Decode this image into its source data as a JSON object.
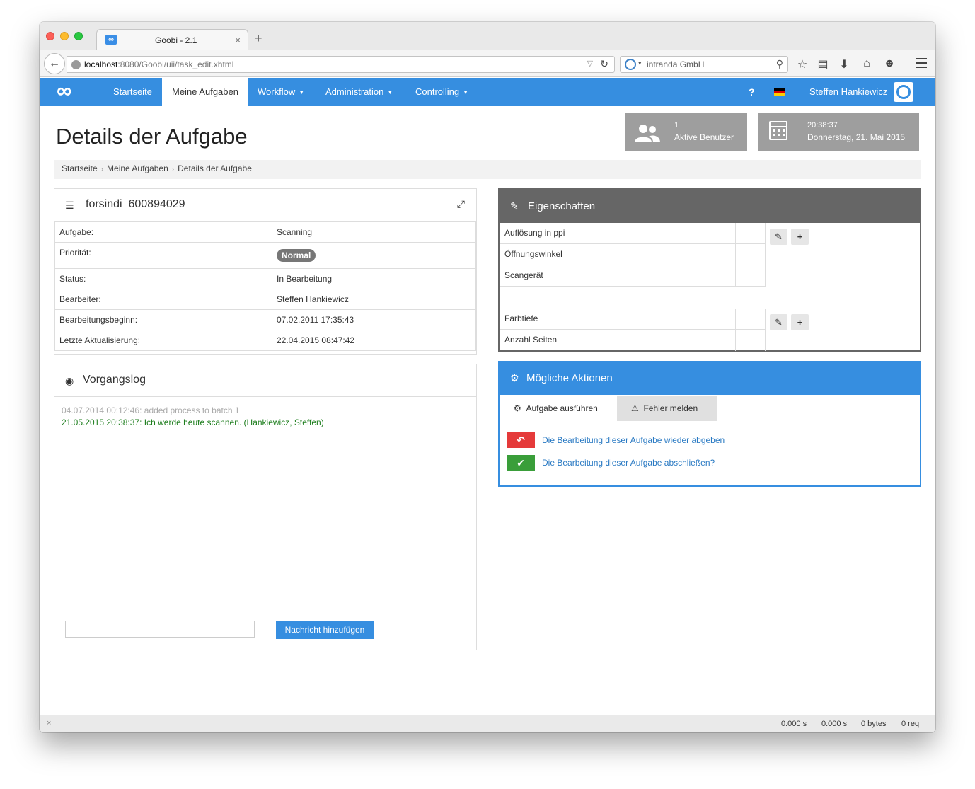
{
  "browser": {
    "tab_title": "Goobi - 2.1",
    "tab_icon_glyph": "∞",
    "tab_close": "×",
    "new_tab": "+",
    "url_host": "localhost",
    "url_path": ":8080/Goobi/uii/task_edit.xhtml",
    "search_text": "intranda GmbH"
  },
  "nav": {
    "logo": "∞",
    "items": [
      {
        "label": "Startseite",
        "caret": false
      },
      {
        "label": "Meine Aufgaben",
        "caret": false
      },
      {
        "label": "Workflow",
        "caret": true
      },
      {
        "label": "Administration",
        "caret": true
      },
      {
        "label": "Controlling",
        "caret": true
      }
    ],
    "active_index": 1,
    "help": "?",
    "user": "Steffen Hankiewicz"
  },
  "page": {
    "title": "Details der Aufgabe",
    "users_count": "1",
    "users_label": "Aktive Benutzer",
    "time": "20:38:37",
    "date": "Donnerstag, 21. Mai 2015"
  },
  "breadcrumb": [
    "Startseite",
    "Meine Aufgaben",
    "Details der Aufgabe"
  ],
  "details": {
    "title": "forsindi_600894029",
    "rows": [
      {
        "key": "Aufgabe:",
        "value": "Scanning"
      },
      {
        "key": "Priorität:",
        "value": "Normal"
      },
      {
        "key": "Status:",
        "value": "In Bearbeitung"
      },
      {
        "key": "Bearbeiter:",
        "value": "Steffen Hankiewicz"
      },
      {
        "key": "Bearbeitungsbeginn:",
        "value": "07.02.2011 17:35:43"
      },
      {
        "key": "Letzte Aktualisierung:",
        "value": "22.04.2015 08:47:42"
      }
    ]
  },
  "log": {
    "title": "Vorgangslog",
    "entries": [
      {
        "text": "04.07.2014 00:12:46: added process to batch 1"
      },
      {
        "text": "21.05.2015 20:38:37: Ich werde heute scannen. (Hankiewicz, Steffen)"
      }
    ],
    "input_value": "",
    "button_label": "Nachricht hinzufügen"
  },
  "properties": {
    "title": "Eigenschaften",
    "group1": [
      "Auflösung in ppi",
      "Öffnungswinkel",
      "Scangerät"
    ],
    "group2": [
      "Farbtiefe",
      "Anzahl Seiten"
    ]
  },
  "actions": {
    "title": "Mögliche Aktionen",
    "tab_execute": "Aufgabe ausführen",
    "tab_error": "Fehler melden",
    "return_label": "Die Bearbeitung dieser Aufgabe wieder abgeben",
    "finish_label": "Die Bearbeitung dieser Aufgabe abschließen?"
  },
  "statusbar": {
    "close": "×",
    "time1": "0.000 s",
    "time2": "0.000 s",
    "bytes": "0 bytes",
    "req": "0 req"
  },
  "colors": {
    "primary": "#368ee0",
    "header_gray": "#666666",
    "badge_gray": "#777777",
    "danger": "#e53a3a",
    "success": "#3a9e3a",
    "log_new": "#1e7e1e"
  }
}
